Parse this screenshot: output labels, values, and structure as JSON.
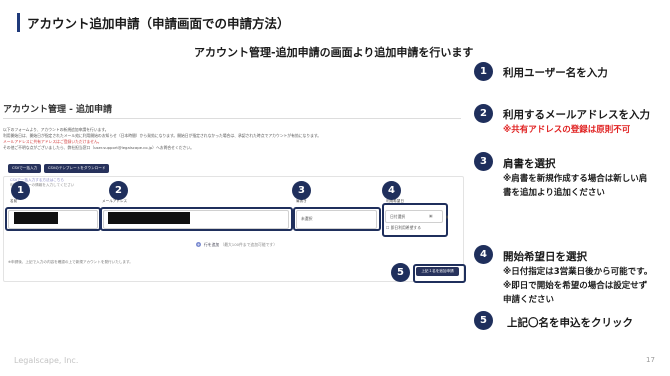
{
  "header": {
    "title": "アカウント追加申請（申請画面での申請方法）",
    "subtitle": "アカウント管理-追加申請の画面より追加申請を行います"
  },
  "screenshot": {
    "page_title": "アカウント管理 - 追加申請",
    "description_lines": [
      "以下のフォームより、アカウントの新規追加申請を行います。",
      "利用開始日は、開始日が指定されたメール宛に利用開始のお知らせ（日本時間）から発効になります。開始日が指定されなかった場合は、承認された時点でアカウントが有効になります。",
      "メールアドレスに共有アドレスはご登録いただけません。",
      "その他ご不明な点がございましたら、弊社担当窓口（user.support@legalscape.co.jp）へお問合せください。"
    ],
    "csv_import_button": "CSVで一括入力",
    "csv_template_button": "CSVのテンプレートをダウンロード",
    "notice_link": "CSVで一括入力する方法はこちら",
    "notice_text": "利用ユーザーの情報を入力してください",
    "columns": {
      "name": "名前",
      "email": "メールアドレス",
      "title": "肩書き",
      "start_date": "利用希望日"
    },
    "title_placeholder": "未選択",
    "date_placeholder": "日付選択",
    "same_day_option": "即日利用希望する",
    "add_row": "行を追加",
    "add_row_note": "（最大100件まで追加可能です）",
    "footer_note": "※申請後、上記で入力の内容を確認の上で新規アカウントを発行いたします。",
    "apply_button": "上記１名を追加申請"
  },
  "markers": [
    "1",
    "2",
    "3",
    "4",
    "5"
  ],
  "steps": [
    {
      "number": "1",
      "label": "利用ユーザー名を入力",
      "notes": []
    },
    {
      "number": "2",
      "label": "利用するメールアドレスを入力",
      "notes": [
        "※共有アドレスの登録は原則不可"
      ]
    },
    {
      "number": "3",
      "label": "肩書を選択",
      "notes": [
        "※肩書を新規作成する場合は新しい肩",
        "書を追加より追加ください"
      ]
    },
    {
      "number": "4",
      "label": "開始希望日を選択",
      "notes": [
        "※日付指定は3営業日後から可能です。",
        "※即日で開始を希望の場合は設定せず",
        "申請ください"
      ]
    },
    {
      "number": "5",
      "label": "上記〇名を申込をクリック",
      "notes": []
    }
  ],
  "footer": {
    "brand": "Legalscape, Inc.",
    "page_number": "17"
  },
  "colors": {
    "accent": "#1f2f5c",
    "warning": "#e02020"
  }
}
